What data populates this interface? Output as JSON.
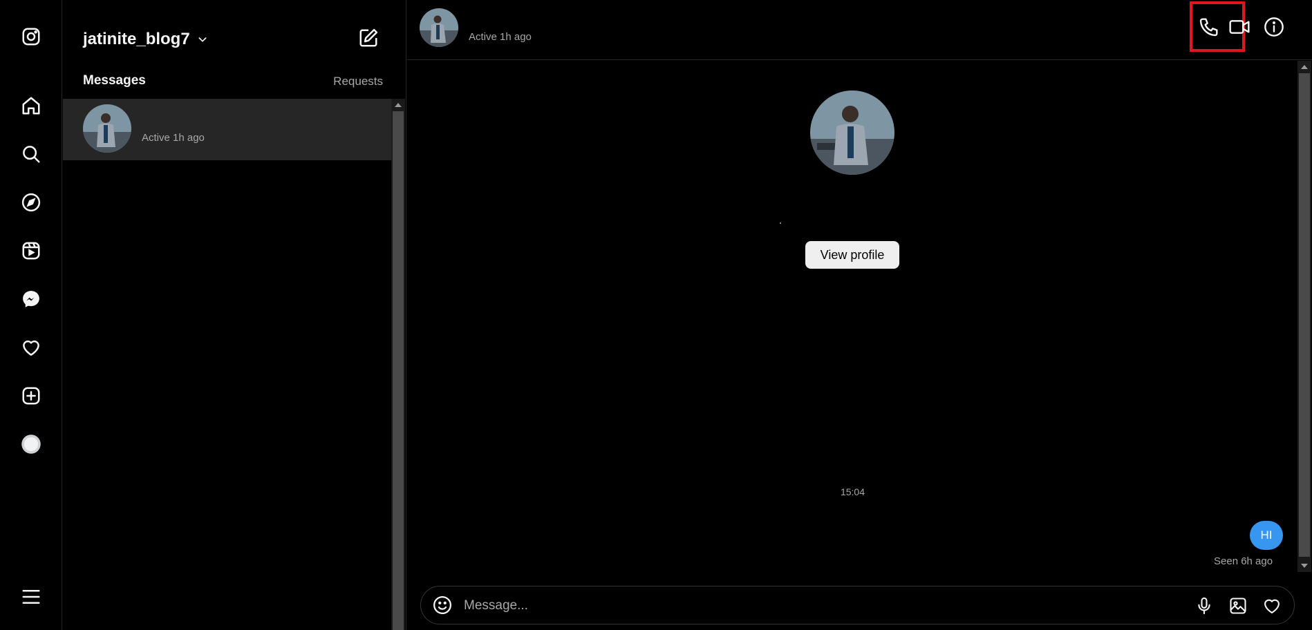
{
  "rail": {
    "items": [
      {
        "name": "instagram-logo-icon"
      },
      {
        "name": "home-icon"
      },
      {
        "name": "search-icon"
      },
      {
        "name": "explore-icon"
      },
      {
        "name": "reels-icon"
      },
      {
        "name": "messenger-icon"
      },
      {
        "name": "notifications-heart-icon"
      },
      {
        "name": "create-plus-icon"
      },
      {
        "name": "profile-avatar-icon"
      },
      {
        "name": "more-menu-icon"
      }
    ]
  },
  "inbox": {
    "account_name": "jatinite_blog7",
    "tab_messages": "Messages",
    "tab_requests": "Requests",
    "threads": [
      {
        "status": "Active 1h ago"
      }
    ]
  },
  "chat": {
    "header_status": "Active 1h ago",
    "view_profile_label": "View profile",
    "timestamp": "15:04",
    "message_text": "HI",
    "seen_text": "Seen 6h ago",
    "composer_placeholder": "Message..."
  },
  "colors": {
    "background": "#000000",
    "accent_blue": "#3797f0",
    "highlight_red": "#e0161f",
    "muted_text": "#a8a8a8"
  }
}
